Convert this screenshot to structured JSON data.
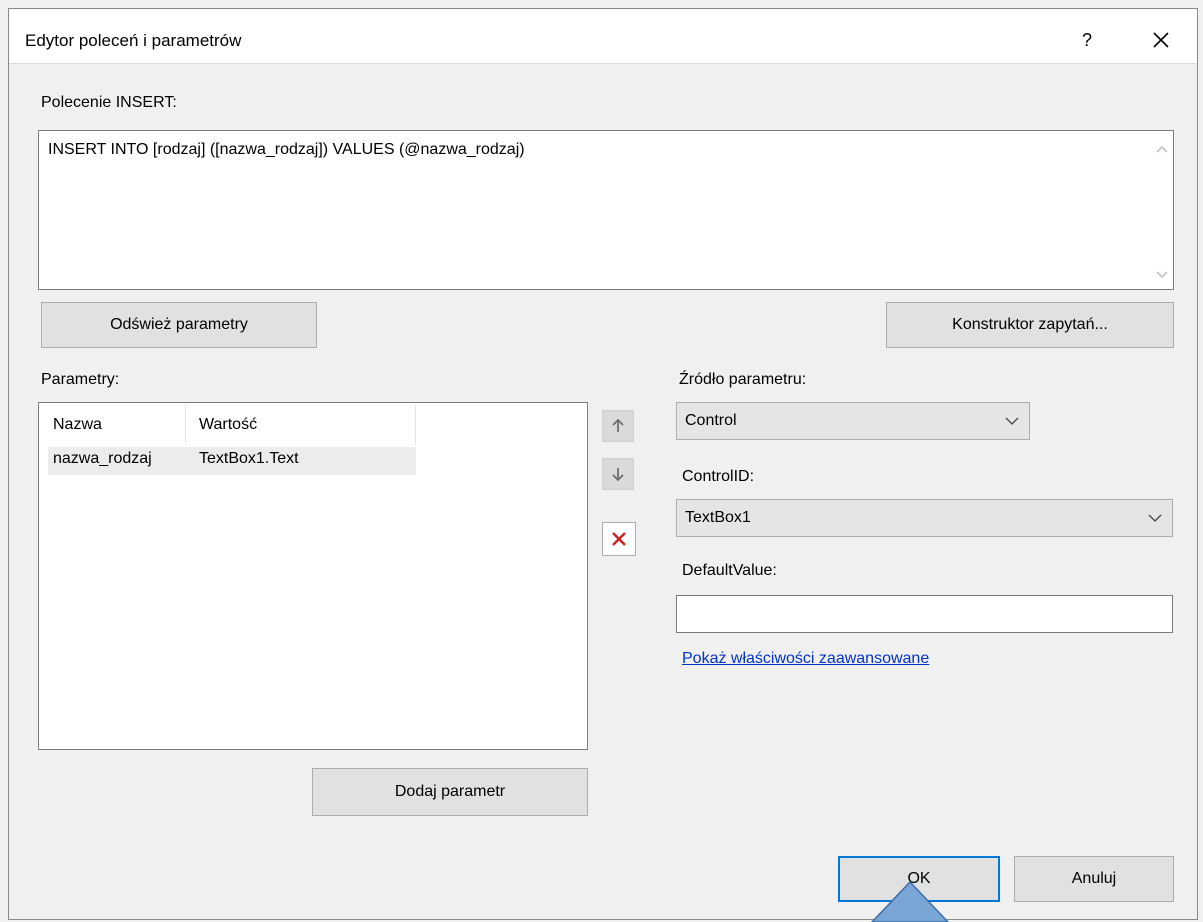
{
  "dialog": {
    "title": "Edytor poleceń i parametrów",
    "help_label": "?",
    "command_label": "Polecenie INSERT:",
    "command_text": "INSERT INTO [rodzaj] ([nazwa_rodzaj]) VALUES (@nazwa_rodzaj)",
    "refresh_label": "Odśwież parametry",
    "query_builder_label": "Konstruktor zapytań...",
    "parameters_label": "Parametry:",
    "columns": [
      "Nazwa",
      "Wartość"
    ],
    "rows": [
      {
        "name": "nazwa_rodzaj",
        "value": "TextBox1.Text"
      }
    ],
    "add_param_label": "Dodaj parametr",
    "source_label": "Źródło parametru:",
    "source_value": "Control",
    "controlid_label": "ControlID:",
    "controlid_value": "TextBox1",
    "default_label": "DefaultValue:",
    "default_value": "",
    "advanced_link": "Pokaż właściwości zaawansowane",
    "ok_label": "OK",
    "cancel_label": "Anuluj"
  },
  "icons": {
    "move_up": "arrow-up-icon",
    "move_down": "arrow-down-icon",
    "delete": "delete-x-icon",
    "close": "close-icon",
    "dropdown": "chevron-down-icon"
  },
  "colors": {
    "accent": "#0078d7",
    "delete": "#cc2222",
    "link": "#0033cc",
    "pointer": "#7aa6d6"
  }
}
